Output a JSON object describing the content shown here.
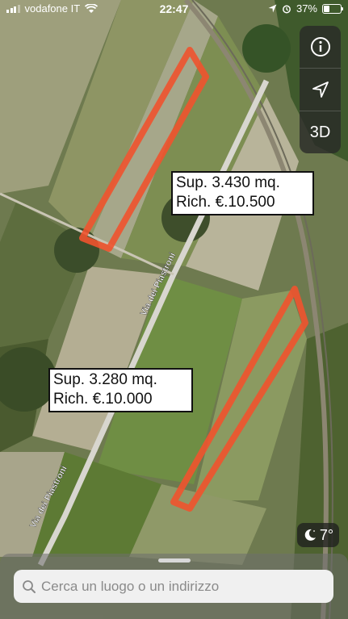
{
  "status_bar": {
    "carrier": "vodafone IT",
    "time": "22:47",
    "battery_percent": "37%",
    "battery_level": 0.37
  },
  "map": {
    "road_labels": [
      "Via dei Piastroni",
      "Via dei Piastroni"
    ],
    "parcel_outline_color": "#f0532e"
  },
  "controls": {
    "info_icon": "info-icon",
    "location_icon": "location-arrow-icon",
    "view_3d_label": "3D"
  },
  "annotations": [
    {
      "line1": "Sup. 3.430 mq.",
      "line2": "Rich. €.10.500"
    },
    {
      "line1": "Sup. 3.280 mq.",
      "line2": "Rich. €.10.000"
    }
  ],
  "weather": {
    "icon": "moon-icon",
    "temperature": "7°"
  },
  "search": {
    "placeholder": "Cerca un luogo o un indirizzo"
  }
}
